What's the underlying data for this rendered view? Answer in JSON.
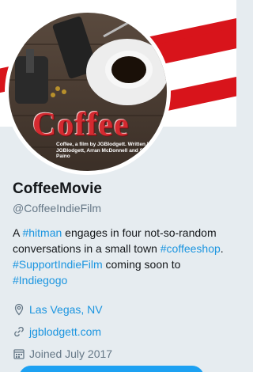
{
  "profile": {
    "display_name": "CoffeeMovie",
    "handle": "@CoffeeIndieFilm",
    "bio": [
      {
        "text": "A ",
        "link": false
      },
      {
        "text": "#hitman",
        "link": true
      },
      {
        "text": " engages in four not-so-random conversations in a small town ",
        "link": false
      },
      {
        "text": "#coffeeshop",
        "link": true
      },
      {
        "text": ". ",
        "link": false
      },
      {
        "text": "#SupportIndieFilm",
        "link": true
      },
      {
        "text": " coming soon to ",
        "link": false
      },
      {
        "text": "#Indiegogo",
        "link": true
      }
    ],
    "location": "Las Vegas, NV",
    "website": "jgblodgett.com",
    "joined": "Joined July 2017"
  },
  "avatar": {
    "title": "Coffee",
    "credit": "Coffee, a film by JGBlodgett. Written by JGBlodgett, Arran McDonnell and Shelly Paino"
  },
  "icons": {
    "location": "location-pin-icon",
    "website": "link-icon",
    "joined": "calendar-icon"
  },
  "colors": {
    "link": "#1b95e0",
    "banner_red": "#d8141b",
    "muted": "#657786"
  }
}
